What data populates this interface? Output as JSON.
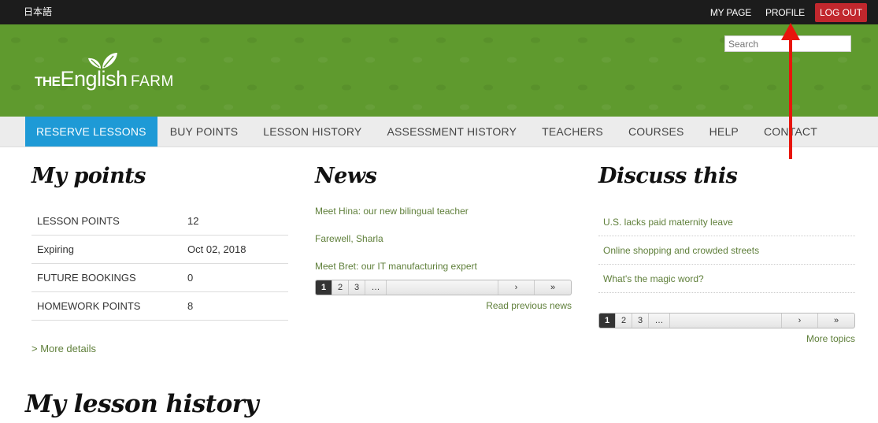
{
  "topbar": {
    "language": "日本語",
    "links": [
      "MY PAGE",
      "PROFILE"
    ],
    "logout": "LOG OUT"
  },
  "header": {
    "logo": {
      "the": "THE",
      "english": "English",
      "farm": "FARM"
    },
    "search_placeholder": "Search"
  },
  "nav": {
    "items": [
      "RESERVE LESSONS",
      "BUY POINTS",
      "LESSON HISTORY",
      "ASSESSMENT HISTORY",
      "TEACHERS",
      "COURSES",
      "HELP",
      "CONTACT"
    ],
    "active_index": 0
  },
  "points": {
    "title": "My points",
    "rows": [
      {
        "label": "LESSON POINTS",
        "value": "12"
      },
      {
        "label": "Expiring",
        "value": "Oct 02, 2018"
      },
      {
        "label": "FUTURE BOOKINGS",
        "value": "0"
      },
      {
        "label": "HOMEWORK POINTS",
        "value": "8"
      }
    ],
    "more_details": "> More details"
  },
  "news": {
    "title": "News",
    "items": [
      "Meet Hina: our new bilingual teacher",
      "Farewell, Sharla",
      "Meet Bret: our IT manufacturing expert"
    ],
    "pager": {
      "pages": [
        "1",
        "2",
        "3"
      ],
      "dots": "…",
      "next": "›",
      "last": "»"
    },
    "read_previous": "Read previous news"
  },
  "discuss": {
    "title": "Discuss this",
    "items": [
      "U.S. lacks paid maternity leave",
      "Online shopping and crowded streets",
      "What's the magic word?"
    ],
    "pager": {
      "pages": [
        "1",
        "2",
        "3"
      ],
      "dots": "…",
      "next": "›",
      "last": "»"
    },
    "more_topics": "More topics"
  },
  "history": {
    "title": "My lesson history"
  },
  "colors": {
    "green": "#5f9a2e",
    "active_nav": "#1e9ad6",
    "logout": "#c1272d",
    "arrow": "#e8150c",
    "link": "#5f7f3a"
  }
}
